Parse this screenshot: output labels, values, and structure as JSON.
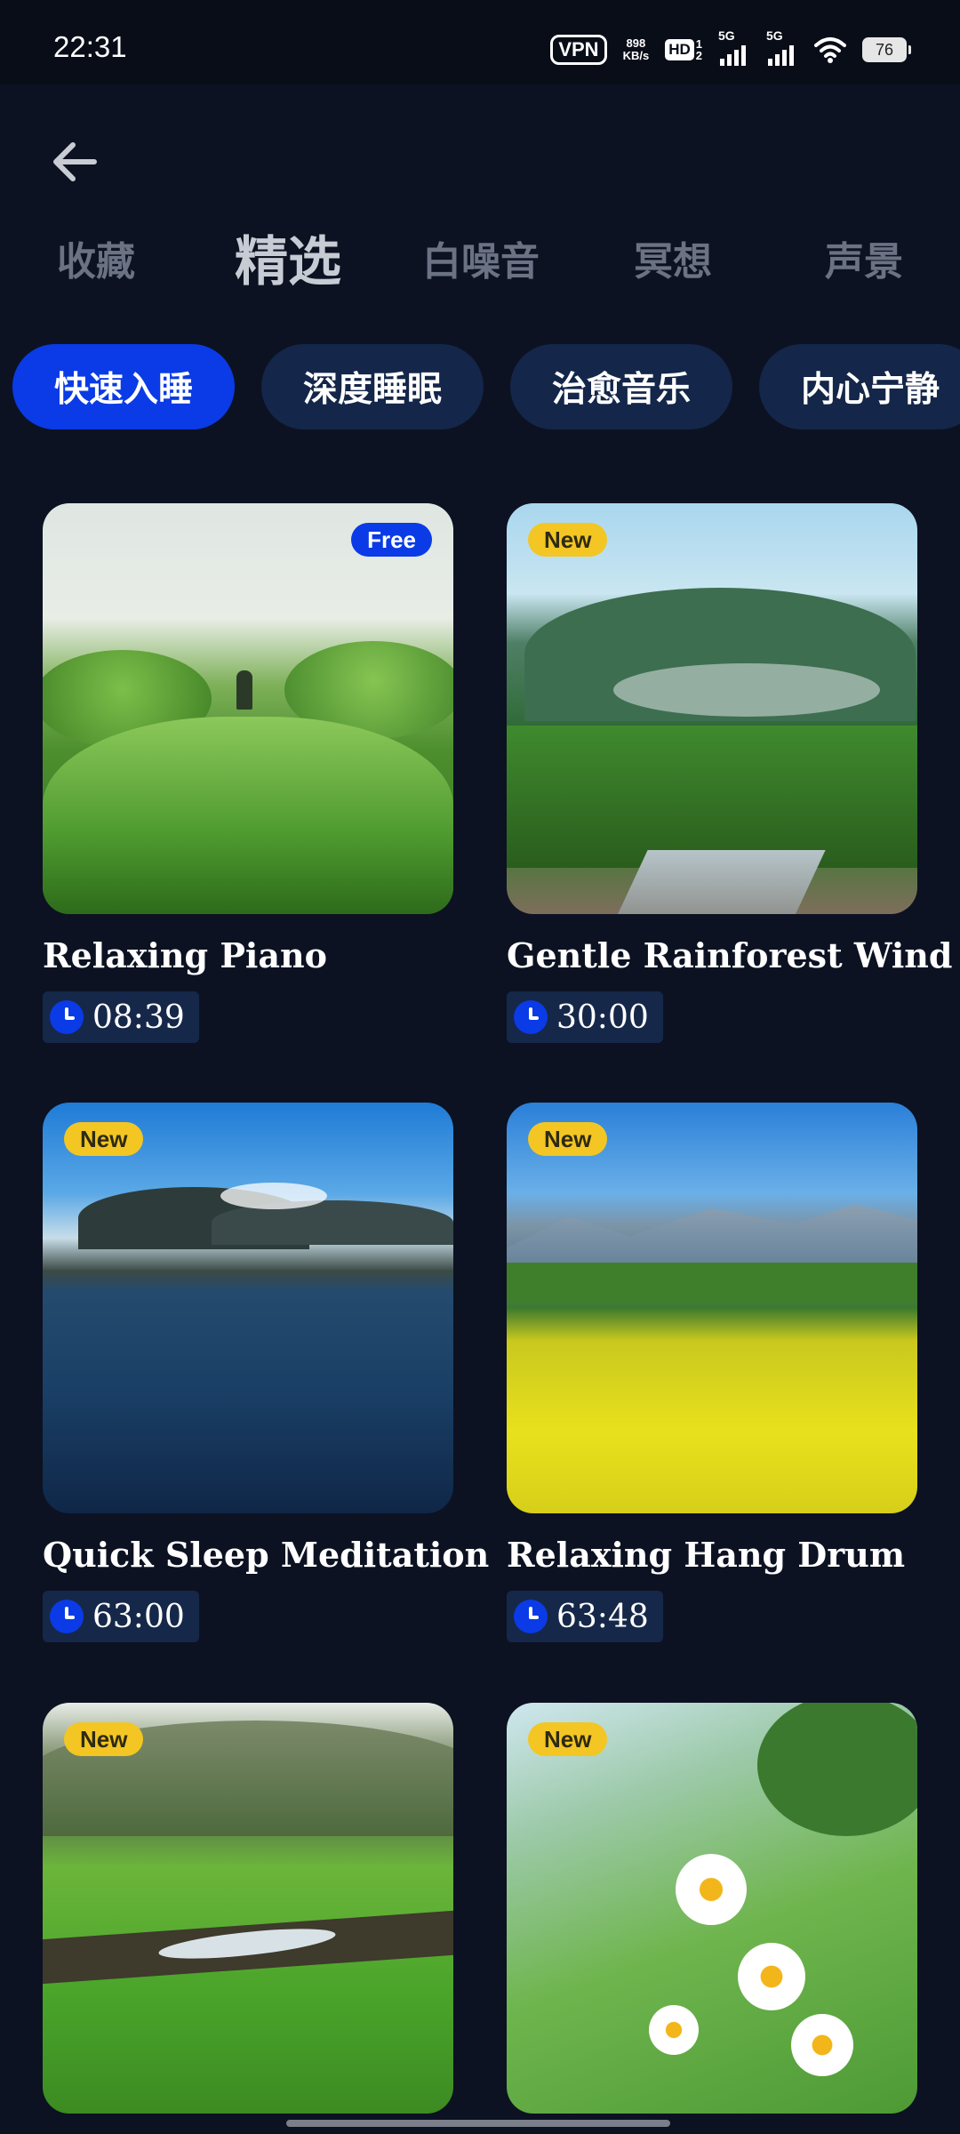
{
  "status_bar": {
    "time": "22:31",
    "vpn": "VPN",
    "speed_value": "898",
    "speed_unit": "KB/s",
    "hd": "HD",
    "hd_sub_top": "1",
    "hd_sub_bottom": "2",
    "sim1": "5G",
    "sim2": "5G",
    "battery": "76"
  },
  "nav": {
    "back_icon": "arrow-left-icon",
    "tabs": [
      {
        "label": "收藏"
      },
      {
        "label": "精选"
      },
      {
        "label": "白噪音"
      },
      {
        "label": "冥想"
      },
      {
        "label": "声景"
      }
    ],
    "active_tab": "精选"
  },
  "chips": [
    {
      "label": "快速入睡"
    },
    {
      "label": "深度睡眠"
    },
    {
      "label": "治愈音乐"
    },
    {
      "label": "内心宁静"
    }
  ],
  "active_chip": "快速入睡",
  "cards": [
    {
      "title": "Relaxing Piano",
      "duration": "08:39",
      "badge": "Free"
    },
    {
      "title": "Gentle Rainforest Wind",
      "duration": "30:00",
      "badge": "New"
    },
    {
      "title": "Quick Sleep Meditation",
      "duration": "63:00",
      "badge": "New"
    },
    {
      "title": "Relaxing Hang Drum",
      "duration": "63:48",
      "badge": "New"
    },
    {
      "badge": "New"
    },
    {
      "badge": "New"
    }
  ],
  "colors": {
    "background": "#0c1222",
    "accent_blue": "#0a3be6",
    "chip_inactive": "#142649",
    "new_badge": "#f3c623"
  }
}
